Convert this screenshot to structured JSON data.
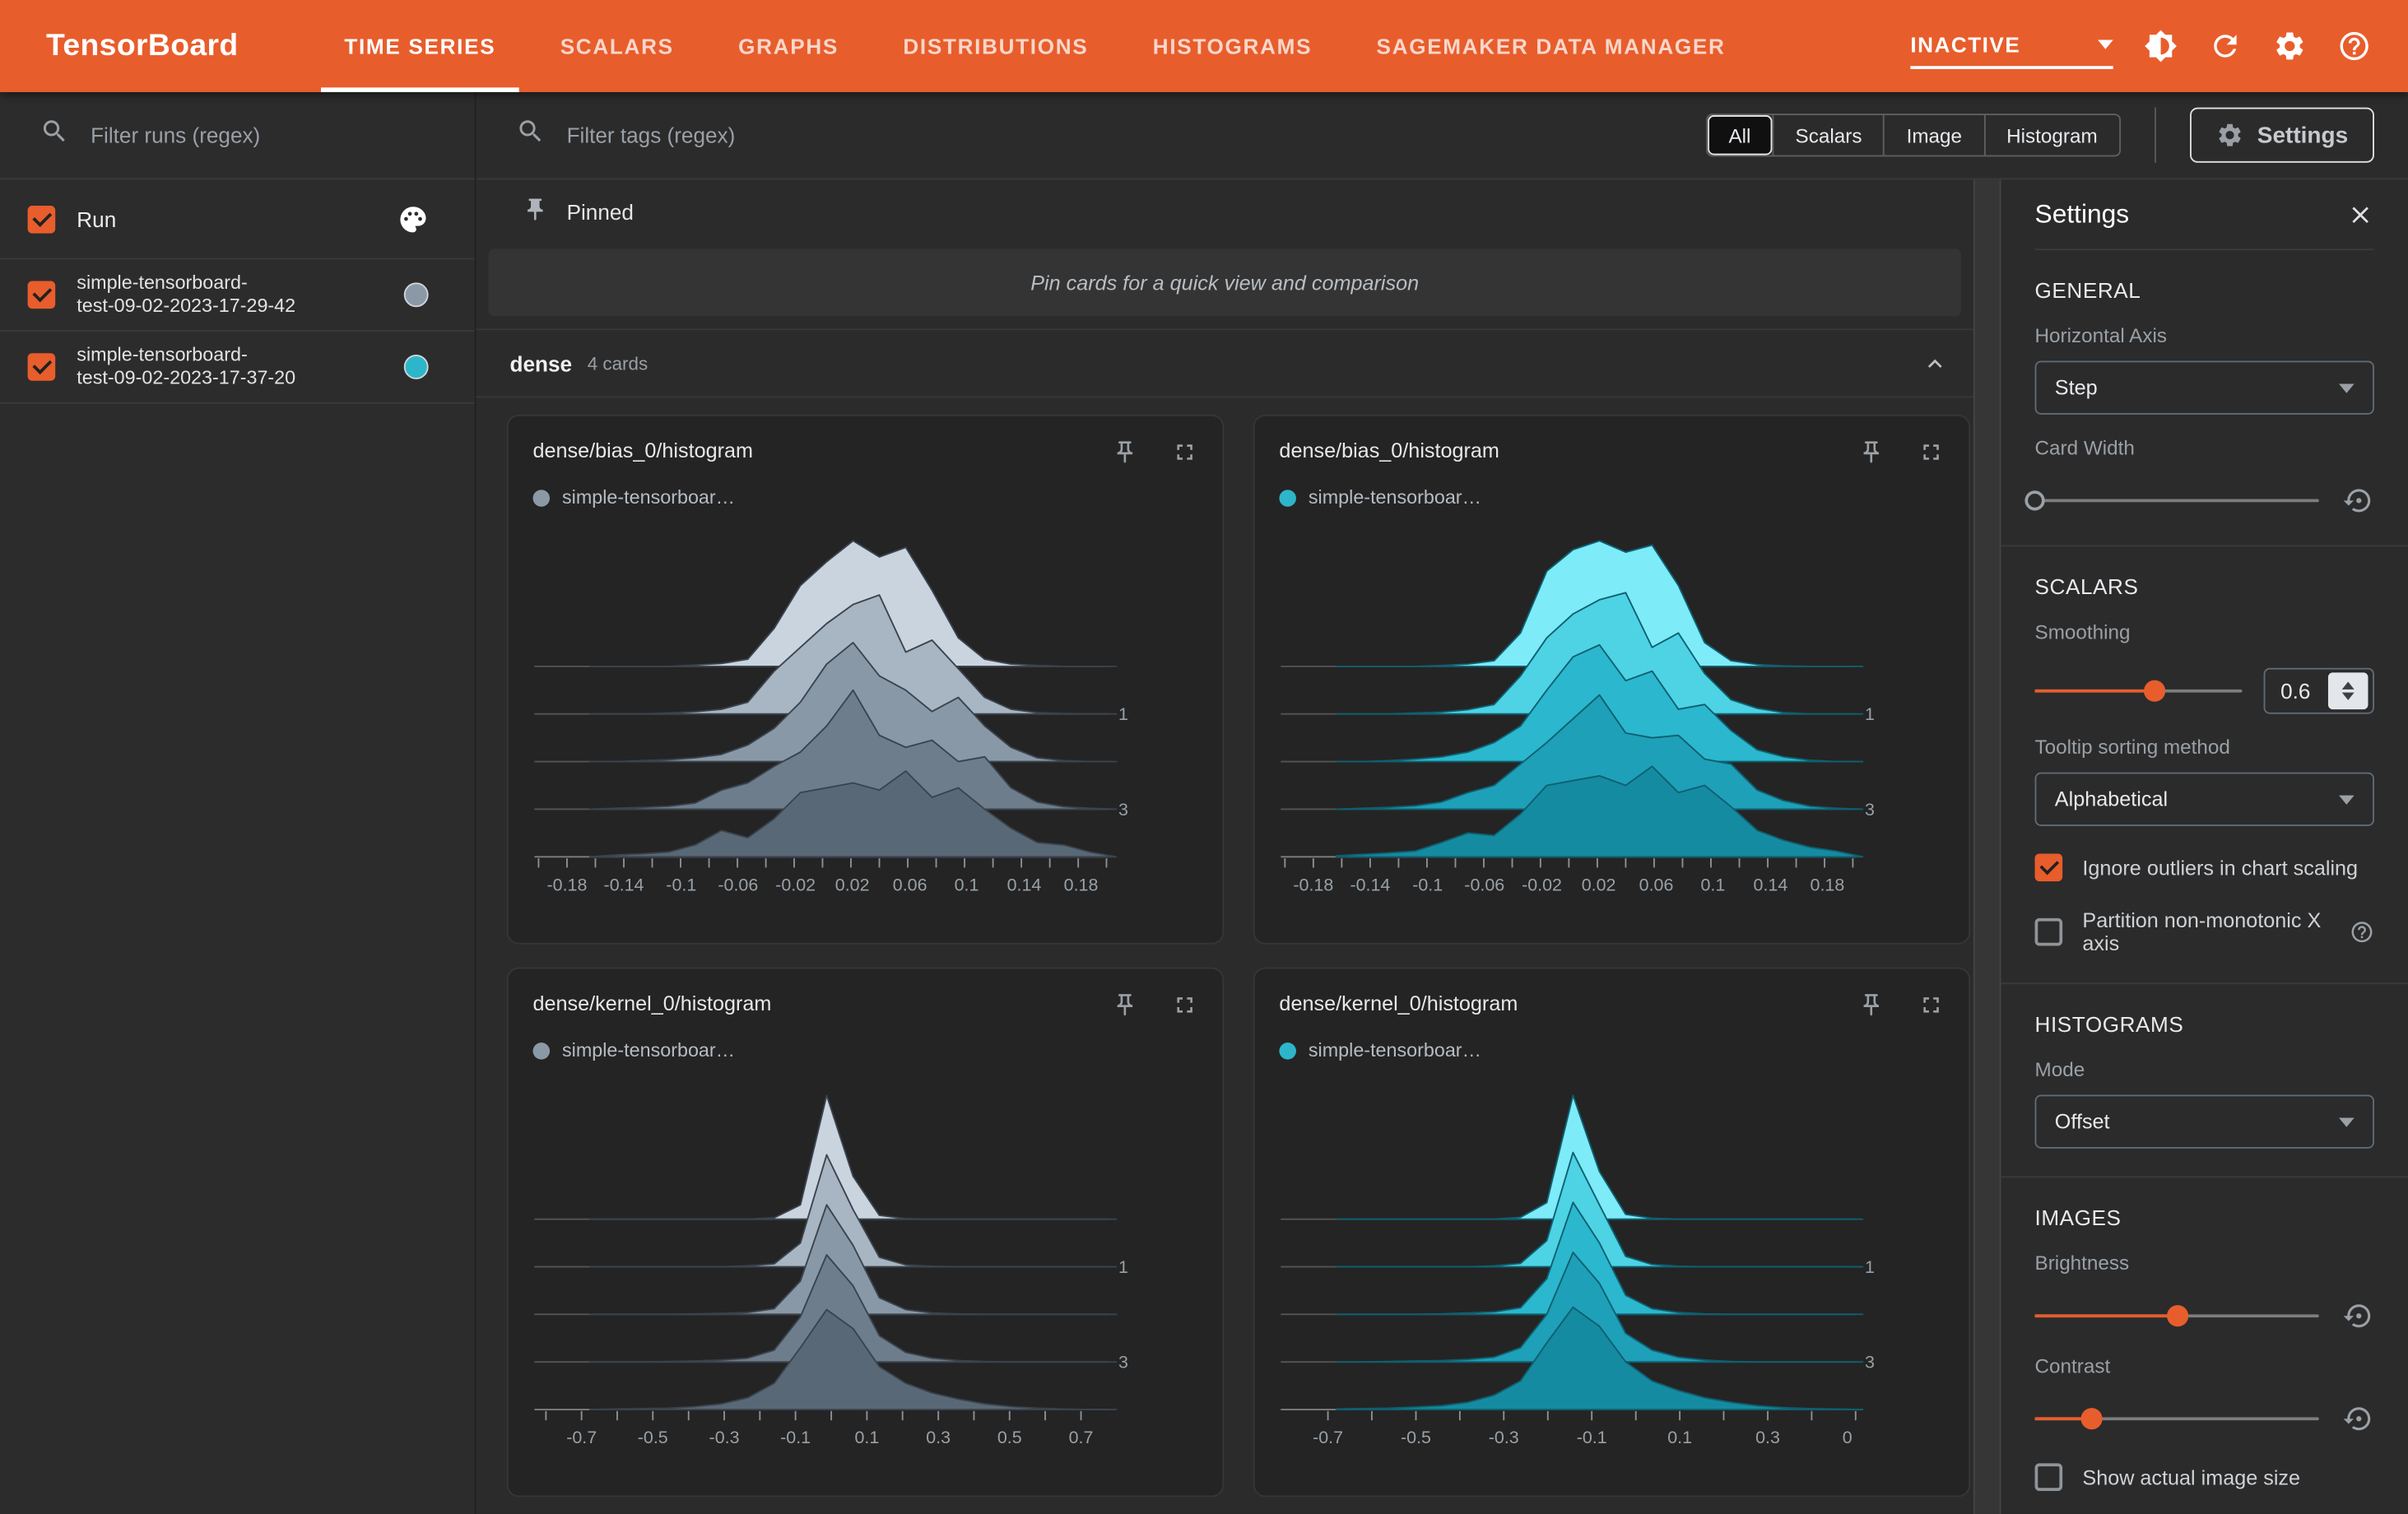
{
  "colors": {
    "accent_orange": "#e85d2c",
    "run1_color": "#8b99a7",
    "run2_color": "#2db6ca",
    "panel_bg": "#2b2b2b",
    "card_bg": "#242424"
  },
  "header": {
    "logo": "TensorBoard",
    "tabs": [
      {
        "label": "TIME SERIES",
        "active": true
      },
      {
        "label": "SCALARS",
        "active": false
      },
      {
        "label": "GRAPHS",
        "active": false
      },
      {
        "label": "DISTRIBUTIONS",
        "active": false
      },
      {
        "label": "HISTOGRAMS",
        "active": false
      },
      {
        "label": "SAGEMAKER DATA MANAGER",
        "active": false
      }
    ],
    "status_dropdown": {
      "value": "INACTIVE"
    },
    "icons": [
      "brightness-icon",
      "refresh-icon",
      "gear-icon",
      "help-icon"
    ]
  },
  "sidebar": {
    "filter_placeholder": "Filter runs (regex)",
    "run_header": {
      "label": "Run",
      "checked": true
    },
    "runs": [
      {
        "name_line1": "simple-tensorboard-",
        "name_line2": "test-09-02-2023-17-29-42",
        "checked": true,
        "color": "#8b99a7"
      },
      {
        "name_line1": "simple-tensorboard-",
        "name_line2": "test-09-02-2023-17-37-20",
        "checked": true,
        "color": "#2db6ca"
      }
    ]
  },
  "toolbar": {
    "filter_placeholder": "Filter tags (regex)",
    "filters": [
      {
        "label": "All",
        "selected": true
      },
      {
        "label": "Scalars",
        "selected": false
      },
      {
        "label": "Image",
        "selected": false
      },
      {
        "label": "Histogram",
        "selected": false
      }
    ],
    "settings_button": "Settings"
  },
  "main": {
    "pinned_label": "Pinned",
    "pin_notice": "Pin cards for a quick view and comparison",
    "section": {
      "name": "dense",
      "count_label": "4 cards"
    }
  },
  "settings": {
    "title": "Settings",
    "general": {
      "heading": "GENERAL",
      "horizontal_axis_label": "Horizontal Axis",
      "horizontal_axis_value": "Step",
      "card_width_label": "Card Width",
      "card_width_fraction": 0
    },
    "scalars": {
      "heading": "SCALARS",
      "smoothing_label": "Smoothing",
      "smoothing_value": "0.6",
      "smoothing_fraction": 0.58,
      "tooltip_label": "Tooltip sorting method",
      "tooltip_value": "Alphabetical",
      "ignore_outliers": {
        "label": "Ignore outliers in chart scaling",
        "checked": true
      },
      "partition_x": {
        "label": "Partition non-monotonic X axis",
        "checked": false
      }
    },
    "histograms": {
      "heading": "HISTOGRAMS",
      "mode_label": "Mode",
      "mode_value": "Offset"
    },
    "images": {
      "heading": "IMAGES",
      "brightness_label": "Brightness",
      "brightness_fraction": 0.5,
      "contrast_label": "Contrast",
      "contrast_fraction": 0.2,
      "show_actual_size": {
        "label": "Show actual image size",
        "checked": false
      }
    }
  },
  "chart_data": [
    {
      "type": "histogram-ridgeline",
      "title": "dense/bias_0/histogram",
      "run": "simple-tensorboar…",
      "run_color": "#8b99a7",
      "mode": "offset",
      "steps": [
        0,
        1,
        2,
        3,
        4
      ],
      "step_axis_labels": [
        {
          "layer_index": 1,
          "label": "1"
        },
        {
          "layer_index": 3,
          "label": "3"
        }
      ],
      "x_ticks": [
        {
          "f": 0.067,
          "label": "-0.18"
        },
        {
          "f": 0.149,
          "label": "-0.14"
        },
        {
          "f": 0.232,
          "label": "-0.1"
        },
        {
          "f": 0.314,
          "label": "-0.06"
        },
        {
          "f": 0.397,
          "label": "-0.02"
        },
        {
          "f": 0.479,
          "label": "0.02"
        },
        {
          "f": 0.562,
          "label": "0.06"
        },
        {
          "f": 0.644,
          "label": "0.1"
        },
        {
          "f": 0.727,
          "label": "0.14"
        },
        {
          "f": 0.809,
          "label": "0.18"
        }
      ],
      "xs": [
        0.1,
        0.138,
        0.176,
        0.214,
        0.252,
        0.29,
        0.328,
        0.366,
        0.404,
        0.442,
        0.48,
        0.518,
        0.556,
        0.594,
        0.632,
        0.67,
        0.708,
        0.746,
        0.784,
        0.822,
        0.86
      ],
      "stroke": "#3a434d",
      "layers": [
        {
          "color": "#c9d4de",
          "heights": [
            0,
            0,
            0,
            0,
            0.03,
            0.06,
            0.15,
            0.8,
            1.7,
            2.2,
            2.64,
            2.3,
            2.5,
            1.6,
            0.6,
            0.15,
            0.05,
            0.02,
            0,
            0,
            0
          ]
        },
        {
          "color": "#a8b5c2",
          "heights": [
            0,
            0,
            0,
            0.02,
            0.05,
            0.1,
            0.25,
            0.9,
            1.4,
            1.9,
            2.3,
            2.5,
            1.3,
            1.55,
            0.95,
            0.35,
            0.1,
            0.03,
            0.01,
            0,
            0
          ]
        },
        {
          "color": "#8898a6",
          "heights": [
            0,
            0,
            0.02,
            0.04,
            0.08,
            0.15,
            0.35,
            0.7,
            1.25,
            2.05,
            2.5,
            1.8,
            1.5,
            1.05,
            1.35,
            0.75,
            0.3,
            0.08,
            0.02,
            0,
            0
          ]
        },
        {
          "color": "#6d7d8c",
          "heights": [
            0,
            0.02,
            0.04,
            0.06,
            0.13,
            0.4,
            0.55,
            0.9,
            1.2,
            1.75,
            2.5,
            1.55,
            1.3,
            1.45,
            1.0,
            1.1,
            0.45,
            0.15,
            0.05,
            0.02,
            0
          ]
        },
        {
          "color": "#596877",
          "heights": [
            0,
            0.04,
            0.06,
            0.1,
            0.25,
            0.55,
            0.4,
            0.8,
            1.35,
            1.45,
            1.55,
            1.4,
            1.8,
            1.25,
            1.45,
            1.0,
            0.6,
            0.3,
            0.25,
            0.1,
            0
          ]
        }
      ]
    },
    {
      "type": "histogram-ridgeline",
      "title": "dense/bias_0/histogram",
      "run": "simple-tensorboar…",
      "run_color": "#2db6ca",
      "mode": "offset",
      "steps": [
        0,
        1,
        2,
        3,
        4
      ],
      "step_axis_labels": [
        {
          "layer_index": 1,
          "label": "1"
        },
        {
          "layer_index": 3,
          "label": "3"
        }
      ],
      "x_ticks": [
        {
          "f": 0.067,
          "label": "-0.18"
        },
        {
          "f": 0.149,
          "label": "-0.14"
        },
        {
          "f": 0.232,
          "label": "-0.1"
        },
        {
          "f": 0.314,
          "label": "-0.06"
        },
        {
          "f": 0.397,
          "label": "-0.02"
        },
        {
          "f": 0.479,
          "label": "0.02"
        },
        {
          "f": 0.562,
          "label": "0.06"
        },
        {
          "f": 0.644,
          "label": "0.1"
        },
        {
          "f": 0.727,
          "label": "0.14"
        },
        {
          "f": 0.809,
          "label": "0.18"
        }
      ],
      "xs": [
        0.1,
        0.138,
        0.176,
        0.214,
        0.252,
        0.29,
        0.328,
        0.366,
        0.404,
        0.442,
        0.48,
        0.518,
        0.556,
        0.594,
        0.632,
        0.67,
        0.708,
        0.746,
        0.784,
        0.822,
        0.86
      ],
      "stroke": "#0e5f70",
      "layers": [
        {
          "color": "#7debf8",
          "heights": [
            0,
            0,
            0,
            0,
            0.02,
            0.05,
            0.12,
            0.7,
            2.0,
            2.45,
            2.64,
            2.4,
            2.55,
            1.7,
            0.5,
            0.12,
            0.04,
            0.01,
            0,
            0,
            0
          ]
        },
        {
          "color": "#4dd3e4",
          "heights": [
            0,
            0,
            0,
            0.02,
            0.04,
            0.09,
            0.2,
            0.8,
            1.6,
            2.1,
            2.4,
            2.55,
            1.4,
            1.7,
            0.85,
            0.3,
            0.12,
            0.03,
            0,
            0,
            0
          ]
        },
        {
          "color": "#2bb7cd",
          "heights": [
            0,
            0,
            0.02,
            0.05,
            0.1,
            0.2,
            0.4,
            0.75,
            1.5,
            2.2,
            2.45,
            1.7,
            1.9,
            1.1,
            1.2,
            0.65,
            0.25,
            0.1,
            0.03,
            0,
            0
          ]
        },
        {
          "color": "#1da0b8",
          "heights": [
            0,
            0.02,
            0.04,
            0.07,
            0.15,
            0.35,
            0.5,
            0.95,
            1.4,
            1.9,
            2.4,
            1.6,
            1.5,
            1.55,
            1.05,
            0.95,
            0.4,
            0.18,
            0.06,
            0.02,
            0
          ]
        },
        {
          "color": "#158ba1",
          "heights": [
            0.02,
            0.05,
            0.08,
            0.12,
            0.3,
            0.5,
            0.45,
            0.9,
            1.5,
            1.6,
            1.7,
            1.5,
            1.9,
            1.35,
            1.5,
            1.05,
            0.55,
            0.35,
            0.2,
            0.12,
            0
          ]
        }
      ]
    },
    {
      "type": "histogram-ridgeline",
      "title": "dense/kernel_0/histogram",
      "run": "simple-tensorboar…",
      "run_color": "#8b99a7",
      "mode": "offset",
      "steps": [
        0,
        1,
        2,
        3,
        4
      ],
      "step_axis_labels": [
        {
          "layer_index": 1,
          "label": "1"
        },
        {
          "layer_index": 3,
          "label": "3"
        }
      ],
      "x_ticks": [
        {
          "f": 0.088,
          "label": "-0.7"
        },
        {
          "f": 0.191,
          "label": "-0.5"
        },
        {
          "f": 0.294,
          "label": "-0.3"
        },
        {
          "f": 0.397,
          "label": "-0.1"
        },
        {
          "f": 0.5,
          "label": "0.1"
        },
        {
          "f": 0.603,
          "label": "0.3"
        },
        {
          "f": 0.706,
          "label": "0.5"
        },
        {
          "f": 0.809,
          "label": "0.7"
        }
      ],
      "xs": [
        0.1,
        0.138,
        0.176,
        0.214,
        0.252,
        0.29,
        0.328,
        0.366,
        0.404,
        0.442,
        0.48,
        0.518,
        0.556,
        0.594,
        0.632,
        0.67,
        0.708,
        0.746,
        0.784,
        0.822,
        0.86
      ],
      "stroke": "#3a434d",
      "layers": [
        {
          "color": "#c9d4de",
          "heights": [
            0,
            0,
            0,
            0,
            0,
            0,
            0,
            0.03,
            0.3,
            2.6,
            0.9,
            0.08,
            0.01,
            0,
            0,
            0,
            0,
            0,
            0,
            0,
            0
          ]
        },
        {
          "color": "#a8b5c2",
          "heights": [
            0,
            0,
            0,
            0,
            0,
            0,
            0.02,
            0.06,
            0.5,
            2.35,
            1.2,
            0.2,
            0.04,
            0.01,
            0,
            0,
            0,
            0,
            0,
            0,
            0
          ]
        },
        {
          "color": "#8898a6",
          "heights": [
            0,
            0,
            0,
            0,
            0.01,
            0.02,
            0.04,
            0.12,
            0.7,
            2.3,
            1.45,
            0.35,
            0.1,
            0.03,
            0.01,
            0,
            0,
            0,
            0,
            0,
            0
          ]
        },
        {
          "color": "#6d7d8c",
          "heights": [
            0,
            0,
            0,
            0.01,
            0.02,
            0.04,
            0.08,
            0.25,
            0.95,
            2.25,
            1.6,
            0.55,
            0.2,
            0.08,
            0.03,
            0.01,
            0,
            0,
            0,
            0,
            0
          ]
        },
        {
          "color": "#596877",
          "heights": [
            0,
            0.01,
            0.02,
            0.03,
            0.06,
            0.12,
            0.25,
            0.55,
            1.3,
            2.1,
            1.7,
            0.9,
            0.55,
            0.35,
            0.22,
            0.12,
            0.06,
            0.03,
            0.01,
            0,
            0
          ]
        }
      ]
    },
    {
      "type": "histogram-ridgeline",
      "title": "dense/kernel_0/histogram",
      "run": "simple-tensorboar…",
      "run_color": "#2db6ca",
      "mode": "offset",
      "steps": [
        0,
        1,
        2,
        3,
        4
      ],
      "step_axis_labels": [
        {
          "layer_index": 1,
          "label": "1"
        },
        {
          "layer_index": 3,
          "label": "3"
        }
      ],
      "x_ticks": [
        {
          "f": 0.088,
          "label": "-0.7"
        },
        {
          "f": 0.215,
          "label": "-0.5"
        },
        {
          "f": 0.342,
          "label": "-0.3"
        },
        {
          "f": 0.469,
          "label": "-0.1"
        },
        {
          "f": 0.596,
          "label": "0.1"
        },
        {
          "f": 0.723,
          "label": "0.3"
        },
        {
          "f": 0.838,
          "label": "0"
        }
      ],
      "xs": [
        0.1,
        0.138,
        0.176,
        0.214,
        0.252,
        0.29,
        0.328,
        0.366,
        0.404,
        0.442,
        0.48,
        0.518,
        0.556,
        0.594,
        0.632,
        0.67,
        0.708,
        0.746,
        0.784,
        0.822,
        0.86
      ],
      "stroke": "#0e5f70",
      "layers": [
        {
          "color": "#7debf8",
          "heights": [
            0,
            0,
            0,
            0,
            0,
            0,
            0,
            0.04,
            0.35,
            2.6,
            1.0,
            0.1,
            0.02,
            0,
            0,
            0,
            0,
            0,
            0,
            0,
            0
          ]
        },
        {
          "color": "#4dd3e4",
          "heights": [
            0,
            0,
            0,
            0,
            0,
            0,
            0.02,
            0.07,
            0.55,
            2.4,
            1.3,
            0.22,
            0.05,
            0.01,
            0,
            0,
            0,
            0,
            0,
            0,
            0
          ]
        },
        {
          "color": "#2bb7cd",
          "heights": [
            0,
            0,
            0,
            0,
            0.01,
            0.03,
            0.05,
            0.14,
            0.75,
            2.35,
            1.5,
            0.4,
            0.12,
            0.04,
            0.01,
            0,
            0,
            0,
            0,
            0,
            0
          ]
        },
        {
          "color": "#1da0b8",
          "heights": [
            0,
            0,
            0.01,
            0.02,
            0.03,
            0.05,
            0.1,
            0.3,
            1.0,
            2.3,
            1.65,
            0.6,
            0.25,
            0.1,
            0.04,
            0.01,
            0,
            0,
            0,
            0,
            0
          ]
        },
        {
          "color": "#158ba1",
          "heights": [
            0.01,
            0.02,
            0.03,
            0.05,
            0.08,
            0.15,
            0.3,
            0.6,
            1.4,
            2.15,
            1.75,
            1.0,
            0.6,
            0.4,
            0.25,
            0.15,
            0.08,
            0.04,
            0.02,
            0.01,
            0
          ]
        }
      ]
    }
  ]
}
